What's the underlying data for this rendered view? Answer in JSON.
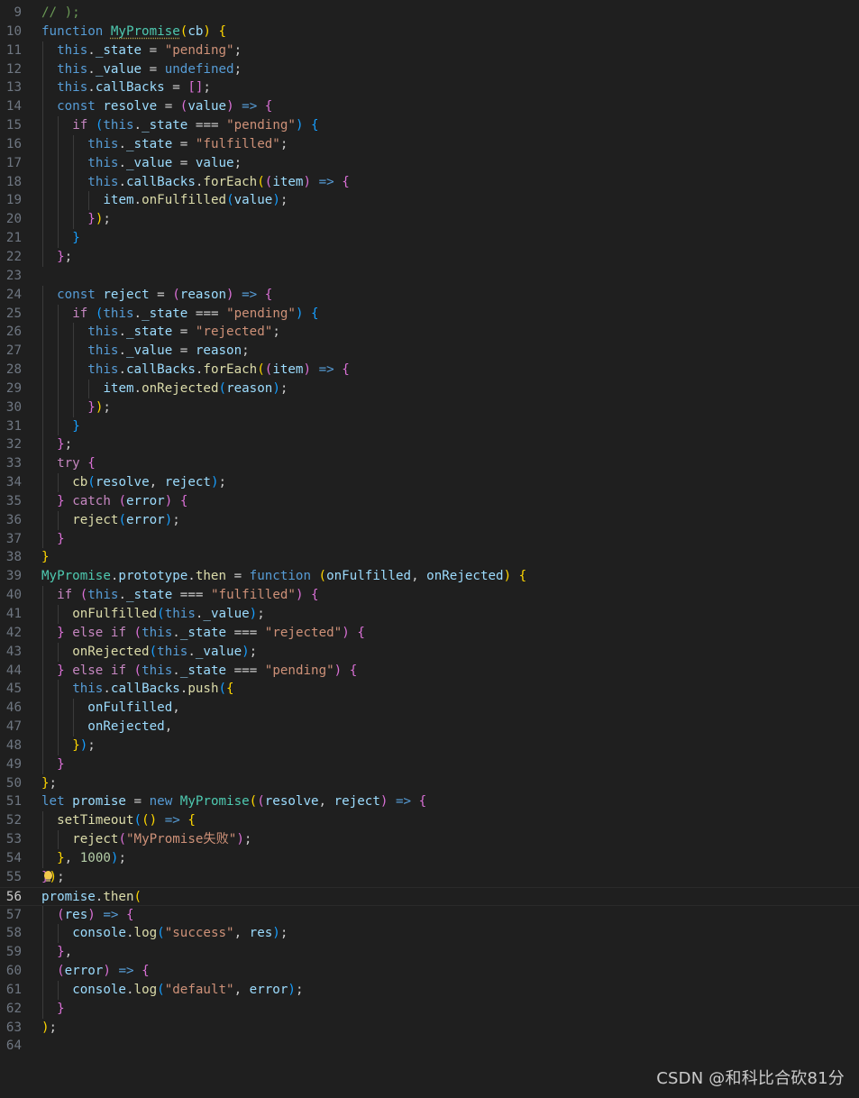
{
  "editor": {
    "language": "javascript",
    "current_line": 56,
    "lines": [
      {
        "n": "9",
        "t": "// );"
      },
      {
        "n": "10",
        "t": "function MyPromise(cb) {"
      },
      {
        "n": "11",
        "t": "  this._state = \"pending\";"
      },
      {
        "n": "12",
        "t": "  this._value = undefined;"
      },
      {
        "n": "13",
        "t": "  this.callBacks = [];"
      },
      {
        "n": "14",
        "t": "  const resolve = (value) => {"
      },
      {
        "n": "15",
        "t": "    if (this._state === \"pending\") {"
      },
      {
        "n": "16",
        "t": "      this._state = \"fulfilled\";"
      },
      {
        "n": "17",
        "t": "      this._value = value;"
      },
      {
        "n": "18",
        "t": "      this.callBacks.forEach((item) => {"
      },
      {
        "n": "19",
        "t": "        item.onFulfilled(value);"
      },
      {
        "n": "20",
        "t": "      });"
      },
      {
        "n": "21",
        "t": "    }"
      },
      {
        "n": "22",
        "t": "  };"
      },
      {
        "n": "23",
        "t": ""
      },
      {
        "n": "24",
        "t": "  const reject = (reason) => {"
      },
      {
        "n": "25",
        "t": "    if (this._state === \"pending\") {"
      },
      {
        "n": "26",
        "t": "      this._state = \"rejected\";"
      },
      {
        "n": "27",
        "t": "      this._value = reason;"
      },
      {
        "n": "28",
        "t": "      this.callBacks.forEach((item) => {"
      },
      {
        "n": "29",
        "t": "        item.onRejected(reason);"
      },
      {
        "n": "30",
        "t": "      });"
      },
      {
        "n": "31",
        "t": "    }"
      },
      {
        "n": "32",
        "t": "  };"
      },
      {
        "n": "33",
        "t": "  try {"
      },
      {
        "n": "34",
        "t": "    cb(resolve, reject);"
      },
      {
        "n": "35",
        "t": "  } catch (error) {"
      },
      {
        "n": "36",
        "t": "    reject(error);"
      },
      {
        "n": "37",
        "t": "  }"
      },
      {
        "n": "38",
        "t": "}"
      },
      {
        "n": "39",
        "t": "MyPromise.prototype.then = function (onFulfilled, onRejected) {"
      },
      {
        "n": "40",
        "t": "  if (this._state === \"fulfilled\") {"
      },
      {
        "n": "41",
        "t": "    onFulfilled(this._value);"
      },
      {
        "n": "42",
        "t": "  } else if (this._state === \"rejected\") {"
      },
      {
        "n": "43",
        "t": "    onRejected(this._value);"
      },
      {
        "n": "44",
        "t": "  } else if (this._state === \"pending\") {"
      },
      {
        "n": "45",
        "t": "    this.callBacks.push({"
      },
      {
        "n": "46",
        "t": "      onFulfilled,"
      },
      {
        "n": "47",
        "t": "      onRejected,"
      },
      {
        "n": "48",
        "t": "    });"
      },
      {
        "n": "49",
        "t": "  }"
      },
      {
        "n": "50",
        "t": "};"
      },
      {
        "n": "51",
        "t": "let promise = new MyPromise((resolve, reject) => {"
      },
      {
        "n": "52",
        "t": "  setTimeout(() => {"
      },
      {
        "n": "53",
        "t": "    reject(\"MyPromise失败\");"
      },
      {
        "n": "54",
        "t": "  }, 1000);"
      },
      {
        "n": "55",
        "t": "});"
      },
      {
        "n": "56",
        "t": "promise.then("
      },
      {
        "n": "57",
        "t": "  (res) => {"
      },
      {
        "n": "58",
        "t": "    console.log(\"success\", res);"
      },
      {
        "n": "59",
        "t": "  },"
      },
      {
        "n": "60",
        "t": "  (error) => {"
      },
      {
        "n": "61",
        "t": "    console.log(\"default\", error);"
      },
      {
        "n": "62",
        "t": "  }"
      },
      {
        "n": "63",
        "t": ");"
      },
      {
        "n": "64",
        "t": ""
      }
    ]
  },
  "watermark": "CSDN @和科比合砍81分",
  "colors": {
    "background": "#1f1f1f",
    "keyword": "#569cd6",
    "control": "#c586c0",
    "string": "#ce9178",
    "number": "#b5cea8",
    "function": "#dcdcaa",
    "variable": "#9cdcfe",
    "type": "#4ec9b0",
    "comment": "#6a9955",
    "line_number": "#6e7681"
  },
  "icons": {
    "line_55_gutter": "lightbulb-icon"
  }
}
